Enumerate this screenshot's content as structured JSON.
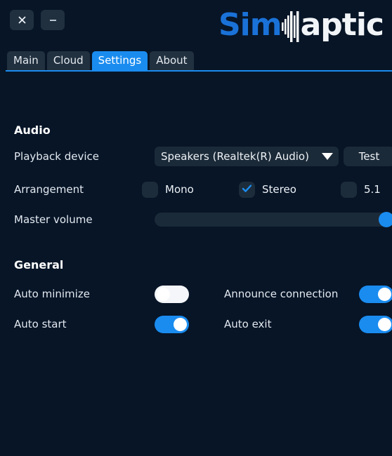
{
  "window": {
    "close_label": "close-window",
    "minimize_label": "minimize-window"
  },
  "brand": {
    "part1": "Sim",
    "part2": "aptic",
    "accent_color": "#1a72d8",
    "text_color": "#f2f5f8"
  },
  "tabs": [
    {
      "label": "Main",
      "active": false
    },
    {
      "label": "Cloud",
      "active": false
    },
    {
      "label": "Settings",
      "active": true
    },
    {
      "label": "About",
      "active": false
    }
  ],
  "sections": {
    "audio": {
      "title": "Audio",
      "playback_device": {
        "label": "Playback device",
        "value": "Speakers (Realtek(R) Audio)",
        "test_button": "Test"
      },
      "arrangement": {
        "label": "Arrangement",
        "options": [
          {
            "label": "Mono",
            "checked": false
          },
          {
            "label": "Stereo",
            "checked": true
          },
          {
            "label": "5.1",
            "checked": false
          }
        ]
      },
      "master_volume": {
        "label": "Master volume",
        "value": 100
      }
    },
    "general": {
      "title": "General",
      "toggles": [
        {
          "label": "Auto minimize",
          "on": false
        },
        {
          "label": "Announce connection",
          "on": true
        },
        {
          "label": "Auto start",
          "on": true
        },
        {
          "label": "Auto exit",
          "on": true
        }
      ]
    }
  },
  "colors": {
    "background": "#071527",
    "accent": "#1a8cf0",
    "control": "#1b2a38"
  }
}
